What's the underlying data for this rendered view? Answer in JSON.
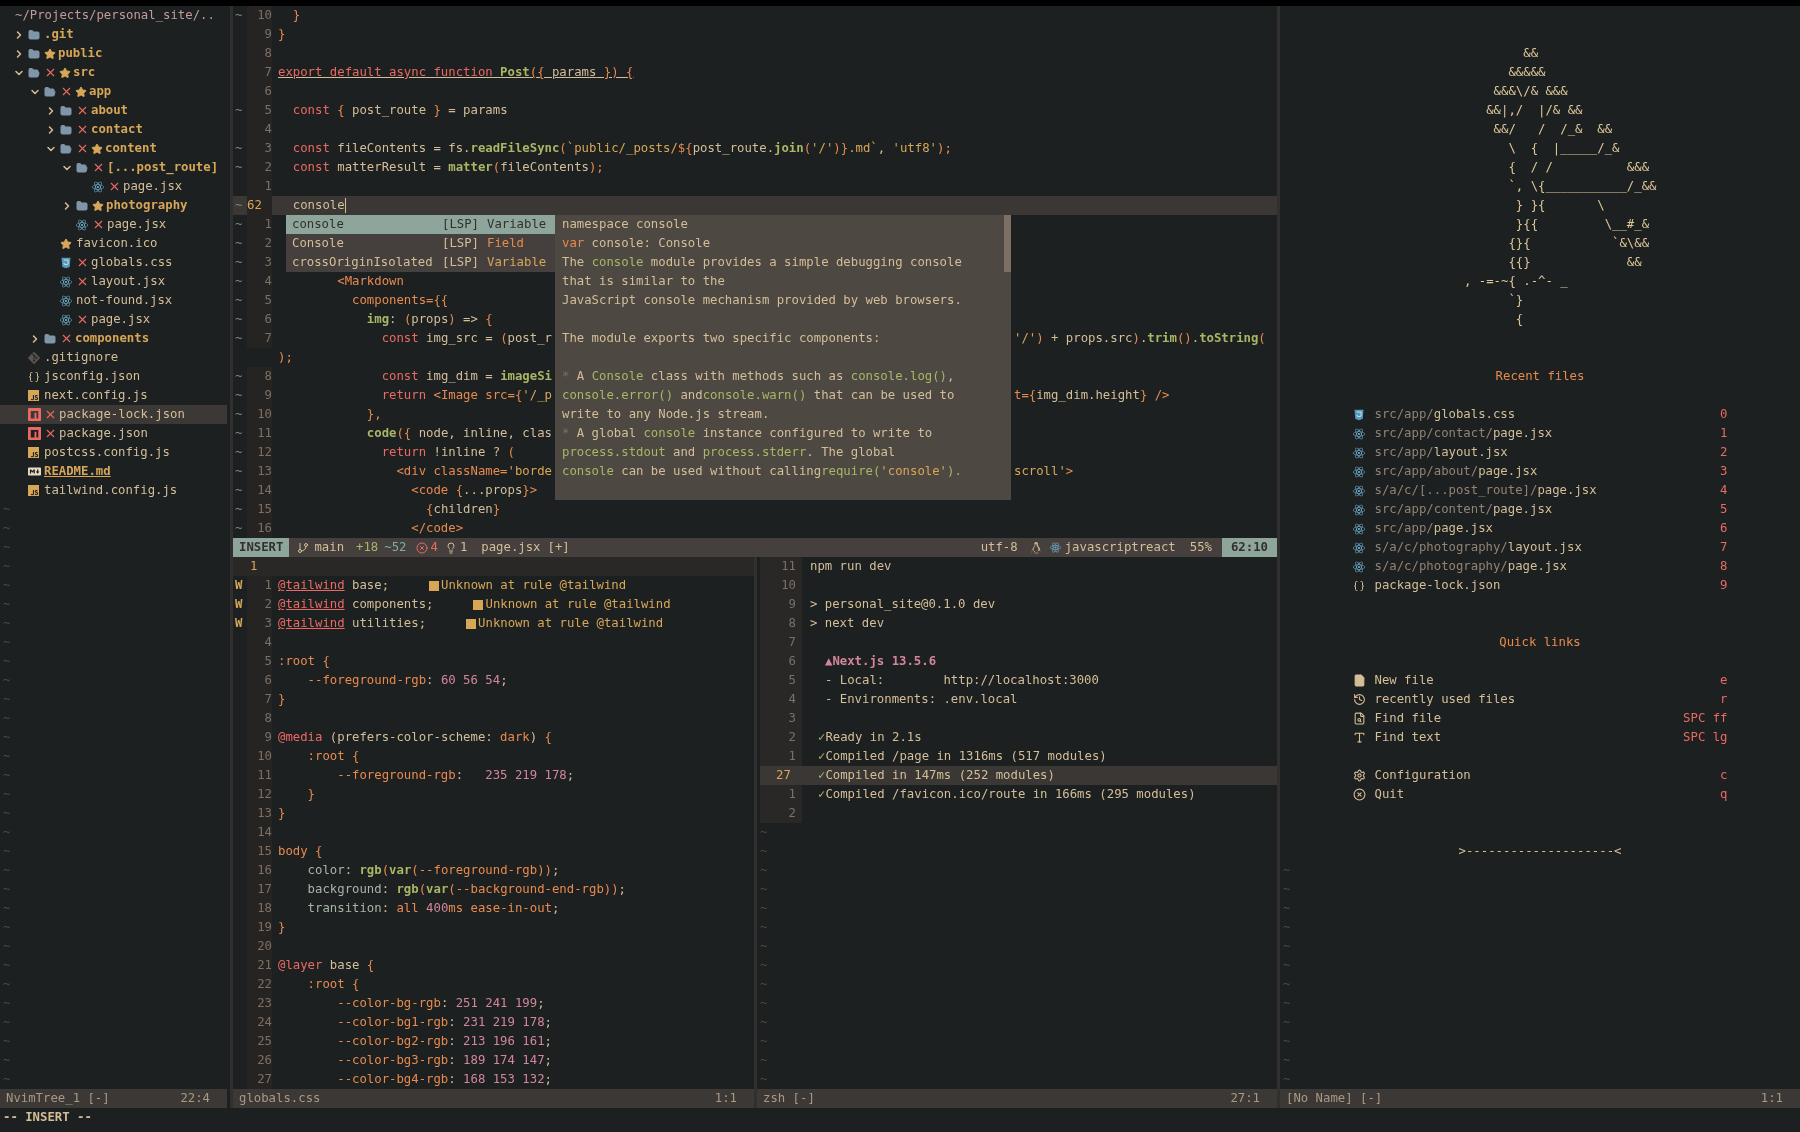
{
  "tree": {
    "header": "~/Projects/personal_site/..",
    "items": [
      {
        "name": ".git",
        "kind": "folder",
        "expanded": false,
        "changed": false,
        "starred": false,
        "selected": false
      },
      {
        "name": "public",
        "kind": "folder",
        "expanded": false,
        "changed": false,
        "starred": true,
        "selected": false
      },
      {
        "name": "src",
        "kind": "folder",
        "expanded": true,
        "changed": true,
        "starred": true,
        "selected": false,
        "children": [
          {
            "name": "app",
            "kind": "folder",
            "expanded": true,
            "changed": true,
            "starred": true,
            "selected": false,
            "children": [
              {
                "name": "about",
                "kind": "folder",
                "expanded": false,
                "changed": true,
                "starred": false,
                "selected": false
              },
              {
                "name": "contact",
                "kind": "folder",
                "expanded": false,
                "changed": true,
                "starred": false,
                "selected": false
              },
              {
                "name": "content",
                "kind": "folder",
                "expanded": true,
                "changed": true,
                "starred": true,
                "selected": false,
                "children": [
                  {
                    "name": "[...post_route]",
                    "kind": "folder",
                    "expanded": true,
                    "changed": true,
                    "starred": false,
                    "selected": false,
                    "children": [
                      {
                        "name": "page.jsx",
                        "kind": "react",
                        "changed": true,
                        "starred": false,
                        "selected": false
                      }
                    ]
                  },
                  {
                    "name": "photography",
                    "kind": "folder",
                    "expanded": false,
                    "changed": false,
                    "starred": true,
                    "selected": false
                  },
                  {
                    "name": "page.jsx",
                    "kind": "react",
                    "changed": true,
                    "starred": false,
                    "selected": false
                  }
                ]
              },
              {
                "name": "favicon.ico",
                "kind": "favicon",
                "changed": false,
                "starred": false,
                "selected": false
              },
              {
                "name": "globals.css",
                "kind": "css",
                "changed": true,
                "starred": false,
                "selected": false
              },
              {
                "name": "layout.jsx",
                "kind": "react",
                "changed": true,
                "starred": false,
                "selected": false
              },
              {
                "name": "not-found.jsx",
                "kind": "react",
                "changed": false,
                "starred": false,
                "selected": false
              },
              {
                "name": "page.jsx",
                "kind": "react",
                "changed": true,
                "starred": false,
                "selected": false
              }
            ]
          },
          {
            "name": "components",
            "kind": "folder",
            "expanded": false,
            "changed": true,
            "starred": false,
            "selected": false
          }
        ]
      },
      {
        "name": ".gitignore",
        "kind": "git",
        "changed": false,
        "starred": false,
        "selected": false
      },
      {
        "name": "jsconfig.json",
        "kind": "json",
        "changed": false,
        "starred": false,
        "selected": false
      },
      {
        "name": "next.config.js",
        "kind": "js",
        "changed": false,
        "starred": false,
        "selected": false
      },
      {
        "name": "package-lock.json",
        "kind": "npm",
        "changed": true,
        "starred": false,
        "selected": true
      },
      {
        "name": "package.json",
        "kind": "npm",
        "changed": true,
        "starred": false,
        "selected": false
      },
      {
        "name": "postcss.config.js",
        "kind": "js",
        "changed": false,
        "starred": false,
        "selected": false
      },
      {
        "name": "README.md",
        "kind": "markdown",
        "changed": false,
        "starred": false,
        "selected": false
      },
      {
        "name": "tailwind.config.js",
        "kind": "js",
        "changed": false,
        "starred": false,
        "selected": false
      }
    ],
    "end_of_buffer": [
      "~",
      "~",
      "~",
      "~",
      "~",
      "~",
      "~",
      "~",
      "~",
      "~",
      "~",
      "~",
      "~",
      "~",
      "~",
      "~",
      "~",
      "~",
      "~",
      "~",
      "~",
      "~",
      "~",
      "~",
      "~",
      "~",
      "~",
      "~",
      "~",
      "~",
      "~"
    ],
    "status": {
      "name": "NvimTree_1 [-]",
      "position": "22:4"
    }
  },
  "editor": {
    "lines": [
      {
        "sign": "~",
        "num": "10",
        "current": false,
        "underline": false,
        "code": [
          {
            "text": "  }",
            "kind": "punc"
          }
        ]
      },
      {
        "num": "9",
        "current": false,
        "underline": false,
        "code": [
          {
            "text": "}",
            "kind": "punc"
          }
        ]
      },
      {
        "num": "8",
        "current": false
      },
      {
        "num": "7",
        "current": false,
        "underline": true,
        "code": [
          {
            "text": "export default async function ",
            "kind": "kw"
          },
          {
            "text": "Post",
            "kind": "fn"
          },
          {
            "text": "({ ",
            "kind": "punc"
          },
          {
            "text": "params",
            "kind": "fg"
          },
          {
            "text": " }) {",
            "kind": "punc"
          }
        ]
      },
      {
        "num": "6",
        "current": false
      },
      {
        "sign": "~",
        "num": "5",
        "current": false,
        "underline": false,
        "code": [
          {
            "text": "  const ",
            "kind": "kw"
          },
          {
            "text": "{ ",
            "kind": "punc"
          },
          {
            "text": "post_route",
            "kind": "fg"
          },
          {
            "text": " } ",
            "kind": "punc"
          },
          {
            "text": "= params",
            "kind": "fg"
          }
        ]
      },
      {
        "num": "4",
        "current": false
      },
      {
        "sign": "~",
        "num": "3",
        "current": false,
        "underline": false,
        "code": [
          {
            "text": "  const ",
            "kind": "kw"
          },
          {
            "text": "fileContents = fs.",
            "kind": "fg"
          },
          {
            "text": "readFileSync",
            "kind": "fn"
          },
          {
            "text": "(",
            "kind": "punc"
          },
          {
            "text": "`public/_posts/",
            "kind": "str"
          },
          {
            "text": "${",
            "kind": "punc"
          },
          {
            "text": "post_route.",
            "kind": "fg"
          },
          {
            "text": "join",
            "kind": "fn"
          },
          {
            "text": "(",
            "kind": "punc"
          },
          {
            "text": "'/'",
            "kind": "str"
          },
          {
            "text": ")}",
            "kind": "punc"
          },
          {
            "text": ".md`",
            "kind": "str"
          },
          {
            "text": ", ",
            "kind": "fg"
          },
          {
            "text": "'utf8'",
            "kind": "str"
          },
          {
            "text": ");",
            "kind": "punc"
          }
        ]
      },
      {
        "sign": "~",
        "num": "2",
        "current": false,
        "underline": false,
        "code": [
          {
            "text": "  const ",
            "kind": "kw"
          },
          {
            "text": "matterResult = ",
            "kind": "fg"
          },
          {
            "text": "matter",
            "kind": "fn"
          },
          {
            "text": "(",
            "kind": "punc"
          },
          {
            "text": "fileContents",
            "kind": "fg"
          },
          {
            "text": ");",
            "kind": "punc"
          }
        ]
      },
      {
        "num": "1",
        "current": false
      },
      {
        "sign": "~",
        "num": "62",
        "current": true,
        "underline": false,
        "code": [
          {
            "text": "  console",
            "kind": "fg"
          }
        ]
      },
      {
        "sign": "~",
        "num": "1",
        "current": false
      },
      {
        "sign": "~",
        "num": "2",
        "current": false
      },
      {
        "sign": "~",
        "num": "3",
        "current": false
      },
      {
        "sign": "~",
        "num": "4",
        "current": false,
        "underline": false,
        "code": [
          {
            "text": "        <Markdown",
            "kind": "tag"
          }
        ]
      },
      {
        "sign": "~",
        "num": "5",
        "current": false,
        "underline": false,
        "code": [
          {
            "text": "          components={{",
            "kind": "tag"
          }
        ]
      },
      {
        "sign": "~",
        "num": "6",
        "current": false,
        "underline": false,
        "code": [
          {
            "text": "            img",
            "kind": "fn"
          },
          {
            "text": ": ",
            "kind": "fg"
          },
          {
            "text": "(",
            "kind": "punc"
          },
          {
            "text": "props",
            "kind": "fg"
          },
          {
            "text": ")",
            "kind": "punc"
          },
          {
            "text": " => ",
            "kind": "fg"
          },
          {
            "text": "{",
            "kind": "punc"
          }
        ]
      },
      {
        "sign": "~",
        "num": "7",
        "current": false,
        "underline": false,
        "code": [
          {
            "text": "              const ",
            "kind": "kw"
          },
          {
            "text": "img_src = ",
            "kind": "fg"
          },
          {
            "text": "(",
            "kind": "punc"
          },
          {
            "text": "post_r",
            "kind": "fg"
          }
        ],
        "right": [
          {
            "text": "'/'",
            "kind": "str"
          },
          {
            "text": ")",
            "kind": "punc"
          },
          {
            "text": " + props.src",
            "kind": "fg"
          },
          {
            "text": ")",
            "kind": "punc"
          },
          {
            "text": ".",
            "kind": "fg"
          },
          {
            "text": "trim",
            "kind": "fn"
          },
          {
            "text": "()",
            "kind": "punc"
          },
          {
            "text": ".",
            "kind": "fg"
          },
          {
            "text": "toString",
            "kind": "fn"
          },
          {
            "text": "(",
            "kind": "punc"
          }
        ]
      },
      {
        "current": false,
        "underline": false,
        "code": [
          {
            "text": ");",
            "kind": "punc"
          }
        ]
      },
      {
        "sign": "~",
        "num": "8",
        "current": false,
        "underline": false,
        "code": [
          {
            "text": "              const ",
            "kind": "kw"
          },
          {
            "text": "img_dim = ",
            "kind": "fg"
          },
          {
            "text": "imageSi",
            "kind": "fn"
          }
        ]
      },
      {
        "sign": "~",
        "num": "9",
        "current": false,
        "underline": false,
        "code": [
          {
            "text": "              return ",
            "kind": "kw"
          },
          {
            "text": "<Image src=",
            "kind": "tag"
          },
          {
            "text": "{",
            "kind": "punc"
          },
          {
            "text": "'/_p",
            "kind": "str"
          }
        ],
        "right": [
          {
            "text": "t=",
            "kind": "tag"
          },
          {
            "text": "{",
            "kind": "punc"
          },
          {
            "text": "img_dim.height",
            "kind": "fg"
          },
          {
            "text": "}",
            "kind": "punc"
          },
          {
            "text": " />",
            "kind": "tag"
          }
        ]
      },
      {
        "sign": "~",
        "num": "10",
        "current": false,
        "underline": false,
        "code": [
          {
            "text": "            },",
            "kind": "punc"
          }
        ]
      },
      {
        "sign": "~",
        "num": "11",
        "current": false,
        "underline": false,
        "code": [
          {
            "text": "            code",
            "kind": "fn"
          },
          {
            "text": "({ ",
            "kind": "punc"
          },
          {
            "text": "node, inline, clas",
            "kind": "fg"
          }
        ]
      },
      {
        "sign": "~",
        "num": "12",
        "current": false,
        "underline": false,
        "code": [
          {
            "text": "              return ",
            "kind": "kw"
          },
          {
            "text": "!inline ? ",
            "kind": "fg"
          },
          {
            "text": "(",
            "kind": "punc"
          }
        ]
      },
      {
        "sign": "~",
        "num": "13",
        "current": false,
        "underline": false,
        "code": [
          {
            "text": "                <div className=",
            "kind": "tag"
          },
          {
            "text": "'borde",
            "kind": "str"
          }
        ],
        "right": [
          {
            "text": "scroll'",
            "kind": "str"
          },
          {
            "text": ">",
            "kind": "tag"
          }
        ]
      },
      {
        "sign": "~",
        "num": "14",
        "current": false,
        "underline": false,
        "code": [
          {
            "text": "                  <code ",
            "kind": "tag"
          },
          {
            "text": "{",
            "kind": "punc"
          },
          {
            "text": "...props",
            "kind": "fg"
          },
          {
            "text": "}",
            "kind": "punc"
          },
          {
            "text": ">",
            "kind": "tag"
          }
        ]
      },
      {
        "sign": "~",
        "num": "15",
        "current": false,
        "underline": false,
        "code": [
          {
            "text": "                    {",
            "kind": "punc"
          },
          {
            "text": "children",
            "kind": "fg"
          },
          {
            "text": "}",
            "kind": "punc"
          }
        ]
      },
      {
        "sign": "~",
        "num": "16",
        "current": false,
        "underline": false,
        "code": [
          {
            "text": "                  </code>",
            "kind": "tag"
          }
        ]
      }
    ],
    "completion": [
      {
        "label": "console",
        "source": "[LSP]",
        "kind": "Variable",
        "selected": true
      },
      {
        "label": "Console",
        "source": "[LSP]",
        "kind": "Field",
        "color": "#e78a4e",
        "selected": false
      },
      {
        "label": "crossOriginIsolated",
        "source": "[LSP]",
        "kind": "Variable",
        "color": "#d8a657",
        "selected": false
      }
    ],
    "documentation": [
      {
        "kind": "text",
        "tokens": [
          {
            "text": "namespace console",
            "kind": "fg"
          }
        ]
      },
      {
        "kind": "text",
        "tokens": [
          {
            "text": "var",
            "kind": "punc"
          },
          {
            "text": " console: Console",
            "kind": "fg"
          }
        ]
      },
      {
        "kind": "text",
        "tokens": [
          {
            "text": "The ",
            "kind": "fg"
          },
          {
            "text": "console",
            "kind": "code"
          },
          {
            "text": " module provides a simple debugging console",
            "kind": "fg"
          }
        ]
      },
      {
        "kind": "text",
        "tokens": [
          {
            "text": "that is similar to the",
            "kind": "fg"
          }
        ]
      },
      {
        "kind": "text",
        "tokens": [
          {
            "text": "JavaScript console mechanism provided by web browsers.",
            "kind": "fg"
          }
        ]
      },
      {
        "kind": "blank"
      },
      {
        "kind": "text",
        "tokens": [
          {
            "text": "The module exports two specific components:",
            "kind": "fg"
          }
        ]
      },
      {
        "kind": "blank"
      },
      {
        "kind": "text",
        "tokens": [
          {
            "text": "*",
            "kind": "dim"
          },
          {
            "text": " A ",
            "kind": "fg"
          },
          {
            "text": "Console",
            "kind": "code"
          },
          {
            "text": " class with methods such as ",
            "kind": "fg"
          },
          {
            "text": "console.log()",
            "kind": "code"
          },
          {
            "text": ",",
            "kind": "fg"
          }
        ]
      },
      {
        "kind": "text",
        "tokens": [
          {
            "text": "console.error()",
            "kind": "code"
          },
          {
            "text": " and",
            "kind": "fg"
          },
          {
            "text": "console.warn()",
            "kind": "code"
          },
          {
            "text": " that can be used to",
            "kind": "fg"
          }
        ]
      },
      {
        "kind": "text",
        "tokens": [
          {
            "text": "write to any Node.js stream.",
            "kind": "fg"
          }
        ]
      },
      {
        "kind": "text",
        "tokens": [
          {
            "text": "*",
            "kind": "dim"
          },
          {
            "text": " A global ",
            "kind": "fg"
          },
          {
            "text": "console",
            "kind": "code"
          },
          {
            "text": " instance configured to write to",
            "kind": "fg"
          }
        ]
      },
      {
        "kind": "text",
        "tokens": [
          {
            "text": "process.stdout",
            "kind": "code"
          },
          {
            "text": " and ",
            "kind": "fg"
          },
          {
            "text": "process.stderr",
            "kind": "code"
          },
          {
            "text": ". The global",
            "kind": "fg"
          }
        ]
      },
      {
        "kind": "text",
        "tokens": [
          {
            "text": "console",
            "kind": "code"
          },
          {
            "text": " can be used without calling",
            "kind": "fg"
          },
          {
            "text": "require(",
            "kind": "code"
          },
          {
            "text": "'console'",
            "kind": "str"
          },
          {
            "text": ").",
            "kind": "code"
          }
        ]
      }
    ],
    "statusline": {
      "mode": "INSERT",
      "branch": "main",
      "added": "+18",
      "changed": "~52",
      "errors": "4",
      "hints": "1",
      "file": "page.jsx",
      "modified": "[+]",
      "encoding": "utf-8",
      "filetype": "javascriptreact",
      "percent": "55%",
      "position": "62:10"
    }
  },
  "css_buffer": {
    "winbar": "1",
    "lines": [
      {
        "sign": "W",
        "num": "1",
        "code": [
          {
            "text": "@tailwind",
            "kind": "at"
          },
          {
            "text": " base;",
            "kind": "fg"
          }
        ],
        "diagnostic": "Unknown at rule @tailwind"
      },
      {
        "sign": "W",
        "num": "2",
        "code": [
          {
            "text": "@tailwind",
            "kind": "at"
          },
          {
            "text": " components;",
            "kind": "fg"
          }
        ],
        "diagnostic": "Unknown at rule @tailwind"
      },
      {
        "sign": "W",
        "num": "3",
        "code": [
          {
            "text": "@tailwind",
            "kind": "at"
          },
          {
            "text": " utilities;",
            "kind": "fg"
          }
        ],
        "diagnostic": "Unknown at rule @tailwind"
      },
      {
        "num": "4"
      },
      {
        "num": "5",
        "code": [
          {
            "text": ":root",
            "kind": "tag"
          },
          {
            "text": " {",
            "kind": "punc"
          }
        ]
      },
      {
        "num": "6",
        "code": [
          {
            "text": "    --foreground-rgb",
            "kind": "tag"
          },
          {
            "text": ": ",
            "kind": "fg"
          },
          {
            "text": "60 56 54",
            "kind": "num"
          },
          {
            "text": ";",
            "kind": "fg"
          }
        ]
      },
      {
        "num": "7",
        "code": [
          {
            "text": "}",
            "kind": "punc"
          }
        ]
      },
      {
        "num": "8"
      },
      {
        "num": "9",
        "code": [
          {
            "text": "@media",
            "kind": "kw"
          },
          {
            "text": " (prefers-color-scheme: ",
            "kind": "fg"
          },
          {
            "text": "dark",
            "kind": "tag"
          },
          {
            "text": ")",
            "kind": "fg"
          },
          {
            "text": " {",
            "kind": "punc"
          }
        ]
      },
      {
        "num": "10",
        "code": [
          {
            "text": "    :root",
            "kind": "tag"
          },
          {
            "text": " {",
            "kind": "punc"
          }
        ]
      },
      {
        "num": "11",
        "code": [
          {
            "text": "        --foreground-rgb",
            "kind": "tag"
          },
          {
            "text": ":   ",
            "kind": "fg"
          },
          {
            "text": "235 219 178",
            "kind": "num"
          },
          {
            "text": ";",
            "kind": "fg"
          }
        ]
      },
      {
        "num": "12",
        "code": [
          {
            "text": "    }",
            "kind": "punc"
          }
        ]
      },
      {
        "num": "13",
        "code": [
          {
            "text": "}",
            "kind": "punc"
          }
        ]
      },
      {
        "num": "14"
      },
      {
        "num": "15",
        "code": [
          {
            "text": "body",
            "kind": "tag"
          },
          {
            "text": " {",
            "kind": "punc"
          }
        ]
      },
      {
        "num": "16",
        "code": [
          {
            "text": "    color",
            "kind": "prop"
          },
          {
            "text": ": ",
            "kind": "fg"
          },
          {
            "text": "rgb",
            "kind": "fn"
          },
          {
            "text": "(",
            "kind": "punc"
          },
          {
            "text": "var",
            "kind": "fn"
          },
          {
            "text": "(",
            "kind": "punc"
          },
          {
            "text": "--foreground-rgb",
            "kind": "tag"
          },
          {
            "text": "))",
            "kind": "punc"
          },
          {
            "text": ";",
            "kind": "fg"
          }
        ]
      },
      {
        "num": "17",
        "code": [
          {
            "text": "    background",
            "kind": "prop"
          },
          {
            "text": ": ",
            "kind": "fg"
          },
          {
            "text": "rgb",
            "kind": "fn"
          },
          {
            "text": "(",
            "kind": "punc"
          },
          {
            "text": "var",
            "kind": "fn"
          },
          {
            "text": "(",
            "kind": "punc"
          },
          {
            "text": "--background-end-rgb",
            "kind": "tag"
          },
          {
            "text": "))",
            "kind": "punc"
          },
          {
            "text": ";",
            "kind": "fg"
          }
        ]
      },
      {
        "num": "18",
        "code": [
          {
            "text": "    transition",
            "kind": "prop"
          },
          {
            "text": ": ",
            "kind": "fg"
          },
          {
            "text": "all ",
            "kind": "tag"
          },
          {
            "text": "400",
            "kind": "num"
          },
          {
            "text": "ms ease-in-out",
            "kind": "tag"
          },
          {
            "text": ";",
            "kind": "fg"
          }
        ]
      },
      {
        "num": "19",
        "code": [
          {
            "text": "}",
            "kind": "punc"
          }
        ]
      },
      {
        "num": "20"
      },
      {
        "num": "21",
        "code": [
          {
            "text": "@layer",
            "kind": "kw"
          },
          {
            "text": " base ",
            "kind": "fg"
          },
          {
            "text": "{",
            "kind": "punc"
          }
        ]
      },
      {
        "num": "22",
        "code": [
          {
            "text": "    :root",
            "kind": "tag"
          },
          {
            "text": " {",
            "kind": "punc"
          }
        ]
      },
      {
        "num": "23",
        "code": [
          {
            "text": "        --color-bg-rgb",
            "kind": "tag"
          },
          {
            "text": ": ",
            "kind": "fg"
          },
          {
            "text": "251 241 199",
            "kind": "num"
          },
          {
            "text": ";",
            "kind": "fg"
          }
        ]
      },
      {
        "num": "24",
        "code": [
          {
            "text": "        --color-bg1-rgb",
            "kind": "tag"
          },
          {
            "text": ": ",
            "kind": "fg"
          },
          {
            "text": "231 219 178",
            "kind": "num"
          },
          {
            "text": ";",
            "kind": "fg"
          }
        ]
      },
      {
        "num": "25",
        "code": [
          {
            "text": "        --color-bg2-rgb",
            "kind": "tag"
          },
          {
            "text": ": ",
            "kind": "fg"
          },
          {
            "text": "213 196 161",
            "kind": "num"
          },
          {
            "text": ";",
            "kind": "fg"
          }
        ]
      },
      {
        "num": "26",
        "code": [
          {
            "text": "        --color-bg3-rgb",
            "kind": "tag"
          },
          {
            "text": ": ",
            "kind": "fg"
          },
          {
            "text": "189 174 147",
            "kind": "num"
          },
          {
            "text": ";",
            "kind": "fg"
          }
        ]
      },
      {
        "num": "27",
        "code": [
          {
            "text": "        --color-bg4-rgb",
            "kind": "tag"
          },
          {
            "text": ": ",
            "kind": "fg"
          },
          {
            "text": "168 153 132",
            "kind": "num"
          },
          {
            "text": ";",
            "kind": "fg"
          }
        ]
      }
    ],
    "status": {
      "name": "globals.css",
      "position": "1:1"
    }
  },
  "terminal": {
    "lines": [
      {
        "num": "11",
        "kind": "cmd",
        "text": "npm run dev",
        "current": false
      },
      {
        "num": "10",
        "kind": "blank",
        "current": false
      },
      {
        "num": "9",
        "kind": "prompt",
        "mark": ">",
        "text": "personal_site@0.1.0 dev",
        "current": false
      },
      {
        "num": "8",
        "kind": "prompt",
        "mark": ">",
        "text": "next dev",
        "current": false
      },
      {
        "num": "7",
        "kind": "blank",
        "current": false
      },
      {
        "num": "6",
        "kind": "banner",
        "text": "▲Next.js 13.5.6",
        "current": false
      },
      {
        "num": "5",
        "kind": "info",
        "text": "- Local:        http://localhost:3000",
        "current": false
      },
      {
        "num": "4",
        "kind": "info",
        "text": "- Environments: .env.local",
        "current": false
      },
      {
        "num": "3",
        "kind": "blank",
        "current": false
      },
      {
        "num": "2",
        "kind": "check",
        "mark": "✓",
        "text": "Ready in 2.1s",
        "current": false
      },
      {
        "num": "1",
        "kind": "check",
        "mark": "✓",
        "text": "Compiled /page in 1316ms (517 modules)",
        "current": false
      },
      {
        "num": "27",
        "kind": "check",
        "mark": "✓",
        "text": "Compiled in 147ms (252 modules)",
        "current": true
      },
      {
        "num": "1",
        "kind": "check",
        "mark": "✓",
        "text": "Compiled /favicon.ico/route in 166ms (295 modules)",
        "current": false
      },
      {
        "num": "2",
        "kind": "blank",
        "current": false
      }
    ],
    "end_of_buffer": [
      "~",
      "~",
      "~",
      "~",
      "~",
      "~",
      "~",
      "~",
      "~",
      "~",
      "~",
      "~",
      "~",
      "~"
    ],
    "status": {
      "name": "zsh [-]",
      "position": "27:1"
    }
  },
  "dashboard": {
    "art": [
      "        &&",
      "      &&&&&",
      "    &&&\\/& &&&",
      "   &&|,/  |/& &&",
      "    &&/   /  /_&  &&",
      "      \\  {  |_____/_&",
      "      {  / /          &&&",
      "      `, \\{___________/_&&",
      "       } }{       \\",
      "       }{{         \\__#_&",
      "      {}{           `&\\&&",
      "      {{}             &&",
      ", -=-~{ .-^- _",
      "      `}",
      "       {"
    ],
    "recent_title": "Recent files",
    "recent": [
      {
        "kind": "css",
        "dir": "src/app/",
        "file": "globals.css",
        "key": "0"
      },
      {
        "kind": "react",
        "dir": "src/app/contact/",
        "file": "page.jsx",
        "key": "1"
      },
      {
        "kind": "react",
        "dir": "src/app/",
        "file": "layout.jsx",
        "key": "2"
      },
      {
        "kind": "react",
        "dir": "src/app/about/",
        "file": "page.jsx",
        "key": "3"
      },
      {
        "kind": "react",
        "dir": "s/a/c/[...post_route]/",
        "file": "page.jsx",
        "key": "4"
      },
      {
        "kind": "react",
        "dir": "src/app/content/",
        "file": "page.jsx",
        "key": "5"
      },
      {
        "kind": "react",
        "dir": "src/app/",
        "file": "page.jsx",
        "key": "6"
      },
      {
        "kind": "react",
        "dir": "s/a/c/photography/",
        "file": "layout.jsx",
        "key": "7"
      },
      {
        "kind": "react",
        "dir": "s/a/c/photography/",
        "file": "page.jsx",
        "key": "8"
      },
      {
        "kind": "json",
        "file": "package-lock.json",
        "key": "9"
      }
    ],
    "links_title": "Quick links",
    "link_groups": [
      [
        {
          "kind": "file",
          "label": "New file",
          "key": "e"
        },
        {
          "kind": "history",
          "label": "recently used files",
          "key": "r"
        },
        {
          "kind": "find",
          "label": "Find file",
          "key": "SPC ff"
        },
        {
          "kind": "text",
          "label": "Find text",
          "key": "SPC lg"
        }
      ],
      [
        {
          "kind": "config",
          "label": "Configuration",
          "key": "c"
        },
        {
          "kind": "quit",
          "label": "Quit",
          "key": "q"
        }
      ]
    ],
    "footer": ">--------------------<",
    "end_of_buffer": [
      "~",
      "~",
      "~",
      "~",
      "~",
      "~",
      "~",
      "~",
      "~",
      "~",
      "~",
      "~"
    ],
    "status": {
      "name": "[No Name] [-]",
      "position": "1:1"
    }
  },
  "cmdline": "-- INSERT --"
}
